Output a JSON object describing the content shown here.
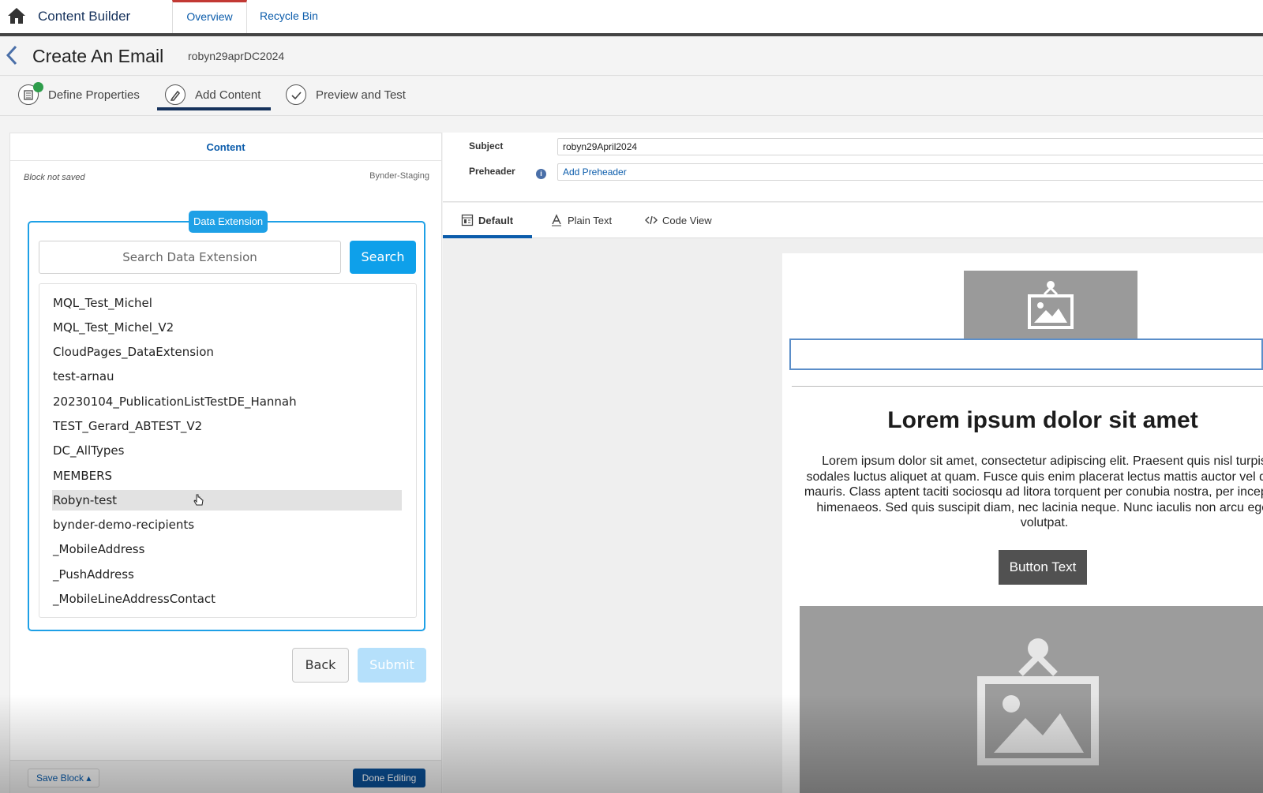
{
  "app": {
    "title": "Content Builder",
    "tabs": [
      {
        "label": "Overview",
        "active": true
      },
      {
        "label": "Recycle Bin",
        "active": false
      }
    ]
  },
  "header": {
    "title": "Create An Email",
    "subtitle": "robyn29aprDC2024"
  },
  "steps": [
    {
      "label": "Define Properties",
      "icon": "checklist-icon",
      "done": true
    },
    {
      "label": "Add Content",
      "icon": "pencil-icon",
      "active": true
    },
    {
      "label": "Preview and Test",
      "icon": "check-icon"
    }
  ],
  "left_panel": {
    "heading": "Content",
    "block_status": "Block not saved",
    "source": "Bynder-Staging",
    "data_extension": {
      "badge": "Data Extension",
      "search_placeholder": "Search Data Extension",
      "search_button": "Search",
      "items": [
        "MQL_Test_Michel",
        "MQL_Test_Michel_V2",
        "CloudPages_DataExtension",
        "test-arnau",
        "20230104_PublicationListTestDE_Hannah",
        "TEST_Gerard_ABTEST_V2",
        "DC_AllTypes",
        "MEMBERS",
        "Robyn-test",
        "bynder-demo-recipients",
        "_MobileAddress",
        "_PushAddress",
        "_MobileLineAddressContact"
      ],
      "hovered_item": "Robyn-test"
    },
    "back_button": "Back",
    "submit_button": "Submit",
    "save_block": "Save Block ▴",
    "done_editing": "Done Editing"
  },
  "right_panel": {
    "subject_label": "Subject",
    "subject_value": "robyn29April2024",
    "preheader_label": "Preheader",
    "preheader_placeholder": "Add Preheader",
    "view_tabs": [
      {
        "label": "Default",
        "icon": "layout-icon",
        "active": true
      },
      {
        "label": "Plain Text",
        "icon": "text-icon"
      },
      {
        "label": "Code View",
        "icon": "code-icon"
      }
    ],
    "email": {
      "heading": "Lorem ipsum dolor sit amet",
      "body": "Lorem ipsum dolor sit amet, consectetur adipiscing elit. Praesent quis nisl turpis sodales luctus aliquet at quam. Fusce quis enim placerat lectus mattis auctor vel quis mauris. Class aptent taciti sociosqu ad litora torquent per conubia nostra, per inceptos himenaeos. Sed quis suscipit diam, nec lacinia neque. Nunc iaculis non arcu eget volutpat.",
      "button": "Button Text"
    }
  },
  "colors": {
    "brand_blue": "#0b5cab",
    "accent_blue": "#1ea0e6",
    "nav_dark": "#16325c",
    "active_tab_top": "#c23934"
  }
}
